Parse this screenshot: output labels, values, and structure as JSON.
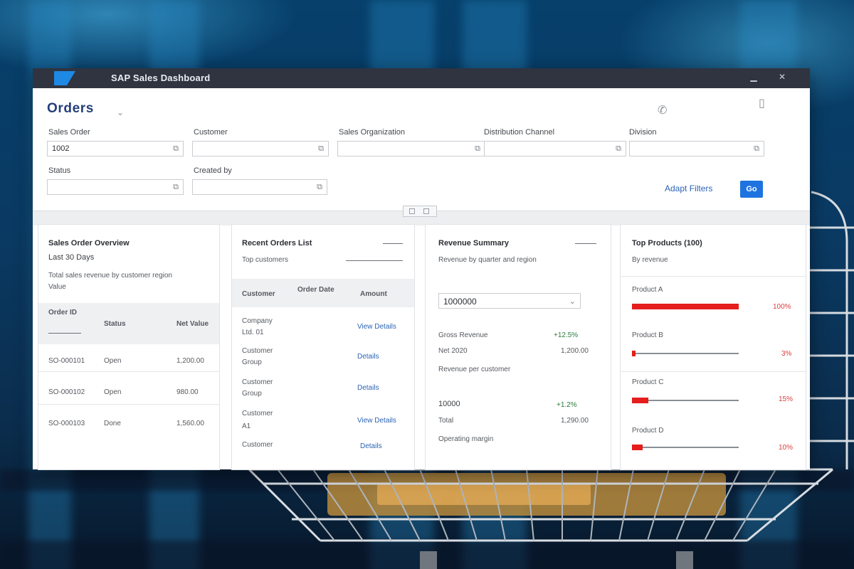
{
  "window": {
    "title": "SAP Sales Dashboard",
    "accent": "#1f73e0",
    "titlebar_color": "#2f3440"
  },
  "header": {
    "title": "Orders",
    "icons": [
      "phone-icon",
      "expand-icon"
    ]
  },
  "filters": {
    "row1": [
      {
        "label": "Sales Order",
        "value": "1002"
      },
      {
        "label": "Customer",
        "value": ""
      },
      {
        "label": "Sales Organization",
        "value": ""
      },
      {
        "label": "Distribution Channel",
        "value": ""
      },
      {
        "label": "Division",
        "value": ""
      }
    ],
    "row2": [
      {
        "label": "Status",
        "value": ""
      },
      {
        "label": "Created by",
        "value": ""
      }
    ],
    "adapt_filters_label": "Adapt Filters",
    "go_label": "Go"
  },
  "panel1": {
    "title": "Sales Order Overview",
    "subtitle": "Last 30 Days",
    "description": "Total sales revenue by customer region",
    "description2": "Value",
    "columns": [
      "Order ID",
      "Status",
      "Net Value"
    ],
    "rows": [
      {
        "order": "SO-000101",
        "status": "Open",
        "value": "1,200.00"
      },
      {
        "order": "SO-000102",
        "status": "Open",
        "value": "980.00"
      },
      {
        "order": "SO-000103",
        "status": "Done",
        "value": "1,560.00"
      }
    ]
  },
  "panel2": {
    "title": "Recent Orders List",
    "subtitle": "Top customers",
    "columns": [
      "Customer",
      "Order Date",
      "Amount"
    ],
    "rows": [
      {
        "customer": "Company",
        "sub": "Ltd. 01",
        "link": "View Details"
      },
      {
        "customer": "Customer",
        "sub": "Group",
        "link": "Details"
      },
      {
        "customer": "Customer",
        "sub": "Group",
        "link": "Details"
      },
      {
        "customer": "Customer",
        "sub": "A1",
        "link": "View Details"
      },
      {
        "customer": "Customer",
        "sub": "",
        "link": "Details"
      }
    ]
  },
  "panel3": {
    "title": "Revenue Summary",
    "subtitle": "Revenue by quarter and region",
    "input_value": "1000000",
    "rows": [
      {
        "label": "Gross Revenue",
        "value": "+12.5%"
      },
      {
        "label": "Net 2020",
        "value": "1,200.00"
      },
      {
        "label": "Revenue per customer",
        "value": ""
      },
      {
        "label": "10000",
        "value": "+1.2%"
      },
      {
        "label": "Total",
        "value": "1,290.00"
      },
      {
        "label": "Operating margin",
        "value": ""
      }
    ]
  },
  "panel4": {
    "title": "Top Products (100)",
    "subtitle": "By revenue",
    "bars": [
      {
        "label": "Product A",
        "value": "100%",
        "fill": 1.0
      },
      {
        "label": "Product B",
        "value": "3%",
        "fill": 0.03
      },
      {
        "label": "Product C",
        "value": "15%",
        "fill": 0.15
      },
      {
        "label": "Product D",
        "value": "10%",
        "fill": 0.1
      }
    ],
    "bar_color": "#e51d1d"
  }
}
